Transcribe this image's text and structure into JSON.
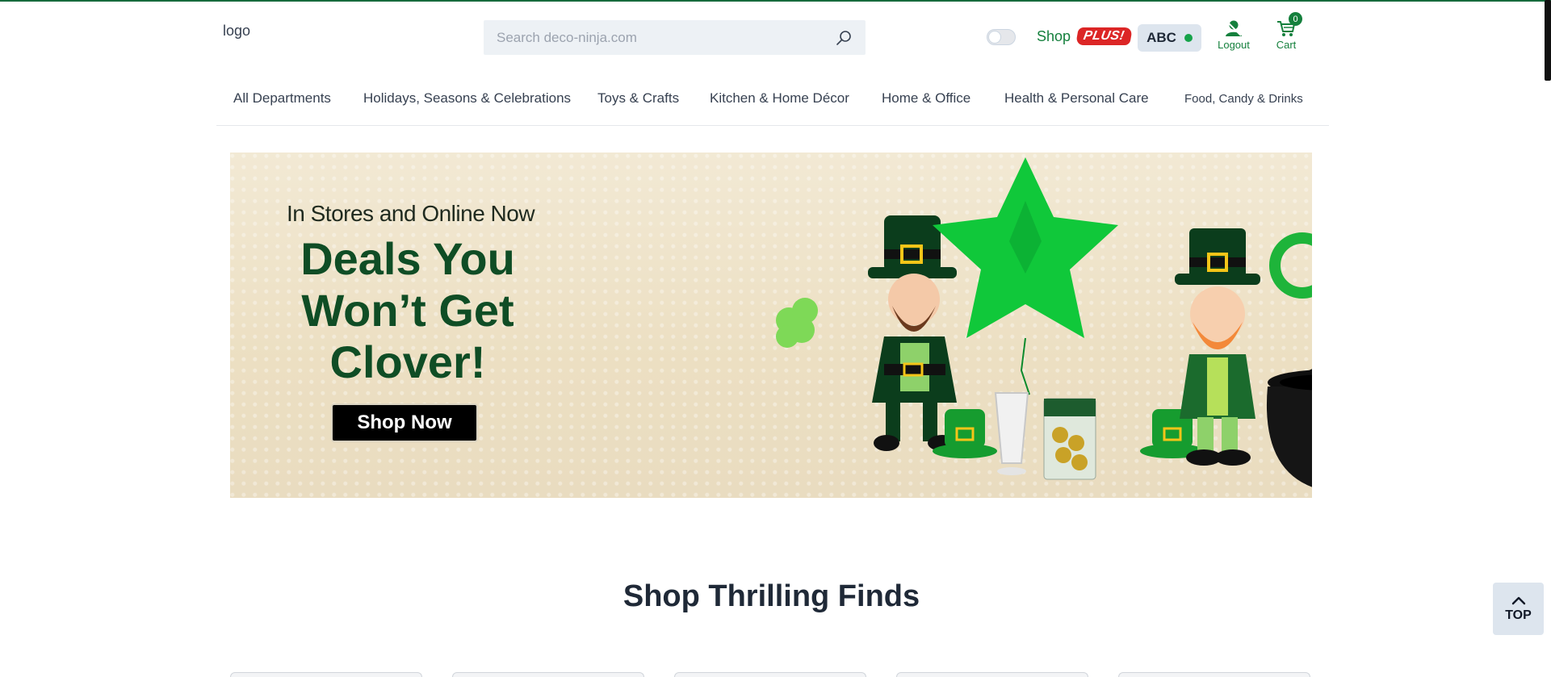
{
  "header": {
    "logo_text": "logo",
    "search": {
      "placeholder": "Search deco-ninja.com",
      "value": ""
    },
    "shop_label": "Shop",
    "plus_badge": "PLUS!",
    "account_label": "ABC",
    "logout_label": "Logout",
    "cart_label": "Cart",
    "cart_count": "0"
  },
  "nav": {
    "items": [
      {
        "label": "All Departments"
      },
      {
        "label": "Holidays, Seasons & Celebrations"
      },
      {
        "label": "Toys & Crafts"
      },
      {
        "label": "Kitchen & Home Décor"
      },
      {
        "label": "Home & Office"
      },
      {
        "label": "Health & Personal Care"
      },
      {
        "label": "Food, Candy & Drinks"
      }
    ]
  },
  "hero": {
    "pre_title": "In Stores and Online Now",
    "title": "Deals You Won’t Get Clover!",
    "cta": "Shop Now"
  },
  "section": {
    "title": "Shop Thrilling Finds"
  },
  "top_button": {
    "label": "TOP"
  },
  "colors": {
    "brand_green": "#15803d",
    "plus_red": "#dc2626",
    "hero_green": "#0f4d25"
  },
  "icons": [
    "search-icon",
    "user-icon",
    "cart-icon",
    "chevron-up-icon"
  ]
}
